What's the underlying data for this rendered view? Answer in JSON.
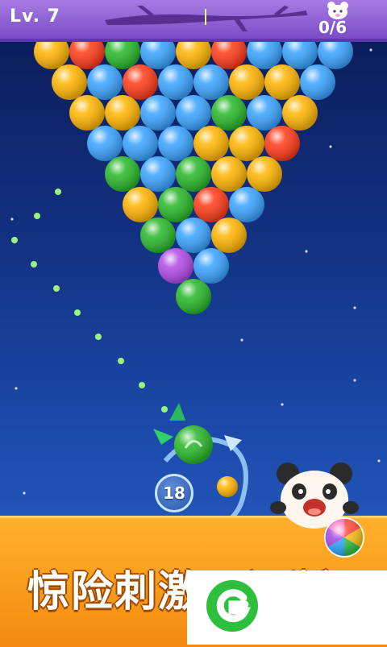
{
  "header": {
    "level_label": "Lv. 7",
    "counter": "0/6"
  },
  "game": {
    "ammo_remaining": "18",
    "colors": {
      "yellow": "#ffb400",
      "red": "#ff3a16",
      "green": "#27b728",
      "blue": "#39a3ff",
      "purple": "#b04ae6"
    },
    "bubble_rows": [
      [
        "yellow",
        "red",
        "green",
        "blue",
        "yellow",
        "red",
        "blue",
        "blue",
        "blue"
      ],
      [
        "yellow",
        "blue",
        "red",
        "blue",
        "blue",
        "yellow",
        "yellow",
        "blue"
      ],
      [
        "yellow",
        "yellow",
        "blue",
        "blue",
        "green",
        "blue",
        "yellow"
      ],
      [
        "blue",
        "blue",
        "blue",
        "yellow",
        "yellow",
        "red"
      ],
      [
        "green",
        "blue",
        "green",
        "yellow",
        "yellow"
      ],
      [
        "yellow",
        "green",
        "red",
        "blue"
      ],
      [
        "green",
        "blue",
        "yellow"
      ],
      [
        "purple",
        "blue"
      ],
      [
        "green"
      ]
    ],
    "shooter_bubble": "green",
    "next_bubble": "yellow",
    "icons": {
      "bear": "bear-face-icon",
      "branch": "tree-branch-icon",
      "panda": "panda-mascot-icon",
      "swap": "rainbow-bubble-icon"
    }
  },
  "banner": {
    "slogan": "惊险刺激不间断",
    "logo": "green-g-logo-icon"
  }
}
